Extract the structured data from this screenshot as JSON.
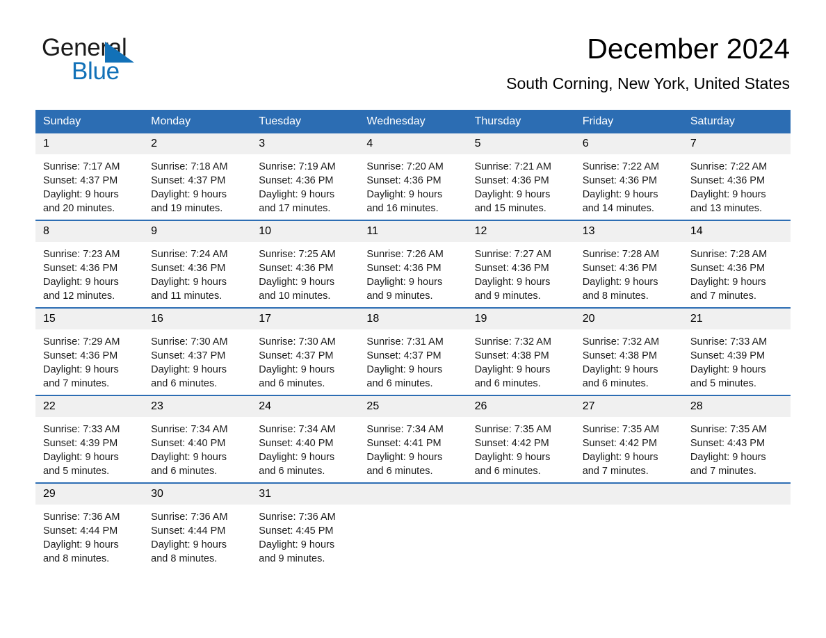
{
  "brand": {
    "logo_line1": "General",
    "logo_line2": "Blue",
    "logo_triangle_icon": "blue-triangle-icon",
    "accent_blue": "#1271b8",
    "header_blue": "#2c6db3",
    "daynum_gray": "#f0f0f0"
  },
  "header": {
    "title": "December 2024",
    "subtitle": "South Corning, New York, United States"
  },
  "calendar": {
    "weekday_headers": [
      "Sunday",
      "Monday",
      "Tuesday",
      "Wednesday",
      "Thursday",
      "Friday",
      "Saturday"
    ],
    "weeks": [
      [
        {
          "day": "1",
          "sunrise": "Sunrise: 7:17 AM",
          "sunset": "Sunset: 4:37 PM",
          "daylight_line1": "Daylight: 9 hours",
          "daylight_line2": "and 20 minutes."
        },
        {
          "day": "2",
          "sunrise": "Sunrise: 7:18 AM",
          "sunset": "Sunset: 4:37 PM",
          "daylight_line1": "Daylight: 9 hours",
          "daylight_line2": "and 19 minutes."
        },
        {
          "day": "3",
          "sunrise": "Sunrise: 7:19 AM",
          "sunset": "Sunset: 4:36 PM",
          "daylight_line1": "Daylight: 9 hours",
          "daylight_line2": "and 17 minutes."
        },
        {
          "day": "4",
          "sunrise": "Sunrise: 7:20 AM",
          "sunset": "Sunset: 4:36 PM",
          "daylight_line1": "Daylight: 9 hours",
          "daylight_line2": "and 16 minutes."
        },
        {
          "day": "5",
          "sunrise": "Sunrise: 7:21 AM",
          "sunset": "Sunset: 4:36 PM",
          "daylight_line1": "Daylight: 9 hours",
          "daylight_line2": "and 15 minutes."
        },
        {
          "day": "6",
          "sunrise": "Sunrise: 7:22 AM",
          "sunset": "Sunset: 4:36 PM",
          "daylight_line1": "Daylight: 9 hours",
          "daylight_line2": "and 14 minutes."
        },
        {
          "day": "7",
          "sunrise": "Sunrise: 7:22 AM",
          "sunset": "Sunset: 4:36 PM",
          "daylight_line1": "Daylight: 9 hours",
          "daylight_line2": "and 13 minutes."
        }
      ],
      [
        {
          "day": "8",
          "sunrise": "Sunrise: 7:23 AM",
          "sunset": "Sunset: 4:36 PM",
          "daylight_line1": "Daylight: 9 hours",
          "daylight_line2": "and 12 minutes."
        },
        {
          "day": "9",
          "sunrise": "Sunrise: 7:24 AM",
          "sunset": "Sunset: 4:36 PM",
          "daylight_line1": "Daylight: 9 hours",
          "daylight_line2": "and 11 minutes."
        },
        {
          "day": "10",
          "sunrise": "Sunrise: 7:25 AM",
          "sunset": "Sunset: 4:36 PM",
          "daylight_line1": "Daylight: 9 hours",
          "daylight_line2": "and 10 minutes."
        },
        {
          "day": "11",
          "sunrise": "Sunrise: 7:26 AM",
          "sunset": "Sunset: 4:36 PM",
          "daylight_line1": "Daylight: 9 hours",
          "daylight_line2": "and 9 minutes."
        },
        {
          "day": "12",
          "sunrise": "Sunrise: 7:27 AM",
          "sunset": "Sunset: 4:36 PM",
          "daylight_line1": "Daylight: 9 hours",
          "daylight_line2": "and 9 minutes."
        },
        {
          "day": "13",
          "sunrise": "Sunrise: 7:28 AM",
          "sunset": "Sunset: 4:36 PM",
          "daylight_line1": "Daylight: 9 hours",
          "daylight_line2": "and 8 minutes."
        },
        {
          "day": "14",
          "sunrise": "Sunrise: 7:28 AM",
          "sunset": "Sunset: 4:36 PM",
          "daylight_line1": "Daylight: 9 hours",
          "daylight_line2": "and 7 minutes."
        }
      ],
      [
        {
          "day": "15",
          "sunrise": "Sunrise: 7:29 AM",
          "sunset": "Sunset: 4:36 PM",
          "daylight_line1": "Daylight: 9 hours",
          "daylight_line2": "and 7 minutes."
        },
        {
          "day": "16",
          "sunrise": "Sunrise: 7:30 AM",
          "sunset": "Sunset: 4:37 PM",
          "daylight_line1": "Daylight: 9 hours",
          "daylight_line2": "and 6 minutes."
        },
        {
          "day": "17",
          "sunrise": "Sunrise: 7:30 AM",
          "sunset": "Sunset: 4:37 PM",
          "daylight_line1": "Daylight: 9 hours",
          "daylight_line2": "and 6 minutes."
        },
        {
          "day": "18",
          "sunrise": "Sunrise: 7:31 AM",
          "sunset": "Sunset: 4:37 PM",
          "daylight_line1": "Daylight: 9 hours",
          "daylight_line2": "and 6 minutes."
        },
        {
          "day": "19",
          "sunrise": "Sunrise: 7:32 AM",
          "sunset": "Sunset: 4:38 PM",
          "daylight_line1": "Daylight: 9 hours",
          "daylight_line2": "and 6 minutes."
        },
        {
          "day": "20",
          "sunrise": "Sunrise: 7:32 AM",
          "sunset": "Sunset: 4:38 PM",
          "daylight_line1": "Daylight: 9 hours",
          "daylight_line2": "and 6 minutes."
        },
        {
          "day": "21",
          "sunrise": "Sunrise: 7:33 AM",
          "sunset": "Sunset: 4:39 PM",
          "daylight_line1": "Daylight: 9 hours",
          "daylight_line2": "and 5 minutes."
        }
      ],
      [
        {
          "day": "22",
          "sunrise": "Sunrise: 7:33 AM",
          "sunset": "Sunset: 4:39 PM",
          "daylight_line1": "Daylight: 9 hours",
          "daylight_line2": "and 5 minutes."
        },
        {
          "day": "23",
          "sunrise": "Sunrise: 7:34 AM",
          "sunset": "Sunset: 4:40 PM",
          "daylight_line1": "Daylight: 9 hours",
          "daylight_line2": "and 6 minutes."
        },
        {
          "day": "24",
          "sunrise": "Sunrise: 7:34 AM",
          "sunset": "Sunset: 4:40 PM",
          "daylight_line1": "Daylight: 9 hours",
          "daylight_line2": "and 6 minutes."
        },
        {
          "day": "25",
          "sunrise": "Sunrise: 7:34 AM",
          "sunset": "Sunset: 4:41 PM",
          "daylight_line1": "Daylight: 9 hours",
          "daylight_line2": "and 6 minutes."
        },
        {
          "day": "26",
          "sunrise": "Sunrise: 7:35 AM",
          "sunset": "Sunset: 4:42 PM",
          "daylight_line1": "Daylight: 9 hours",
          "daylight_line2": "and 6 minutes."
        },
        {
          "day": "27",
          "sunrise": "Sunrise: 7:35 AM",
          "sunset": "Sunset: 4:42 PM",
          "daylight_line1": "Daylight: 9 hours",
          "daylight_line2": "and 7 minutes."
        },
        {
          "day": "28",
          "sunrise": "Sunrise: 7:35 AM",
          "sunset": "Sunset: 4:43 PM",
          "daylight_line1": "Daylight: 9 hours",
          "daylight_line2": "and 7 minutes."
        }
      ],
      [
        {
          "day": "29",
          "sunrise": "Sunrise: 7:36 AM",
          "sunset": "Sunset: 4:44 PM",
          "daylight_line1": "Daylight: 9 hours",
          "daylight_line2": "and 8 minutes."
        },
        {
          "day": "30",
          "sunrise": "Sunrise: 7:36 AM",
          "sunset": "Sunset: 4:44 PM",
          "daylight_line1": "Daylight: 9 hours",
          "daylight_line2": "and 8 minutes."
        },
        {
          "day": "31",
          "sunrise": "Sunrise: 7:36 AM",
          "sunset": "Sunset: 4:45 PM",
          "daylight_line1": "Daylight: 9 hours",
          "daylight_line2": "and 9 minutes."
        },
        {
          "day": "",
          "sunrise": "",
          "sunset": "",
          "daylight_line1": "",
          "daylight_line2": ""
        },
        {
          "day": "",
          "sunrise": "",
          "sunset": "",
          "daylight_line1": "",
          "daylight_line2": ""
        },
        {
          "day": "",
          "sunrise": "",
          "sunset": "",
          "daylight_line1": "",
          "daylight_line2": ""
        },
        {
          "day": "",
          "sunrise": "",
          "sunset": "",
          "daylight_line1": "",
          "daylight_line2": ""
        }
      ]
    ]
  }
}
